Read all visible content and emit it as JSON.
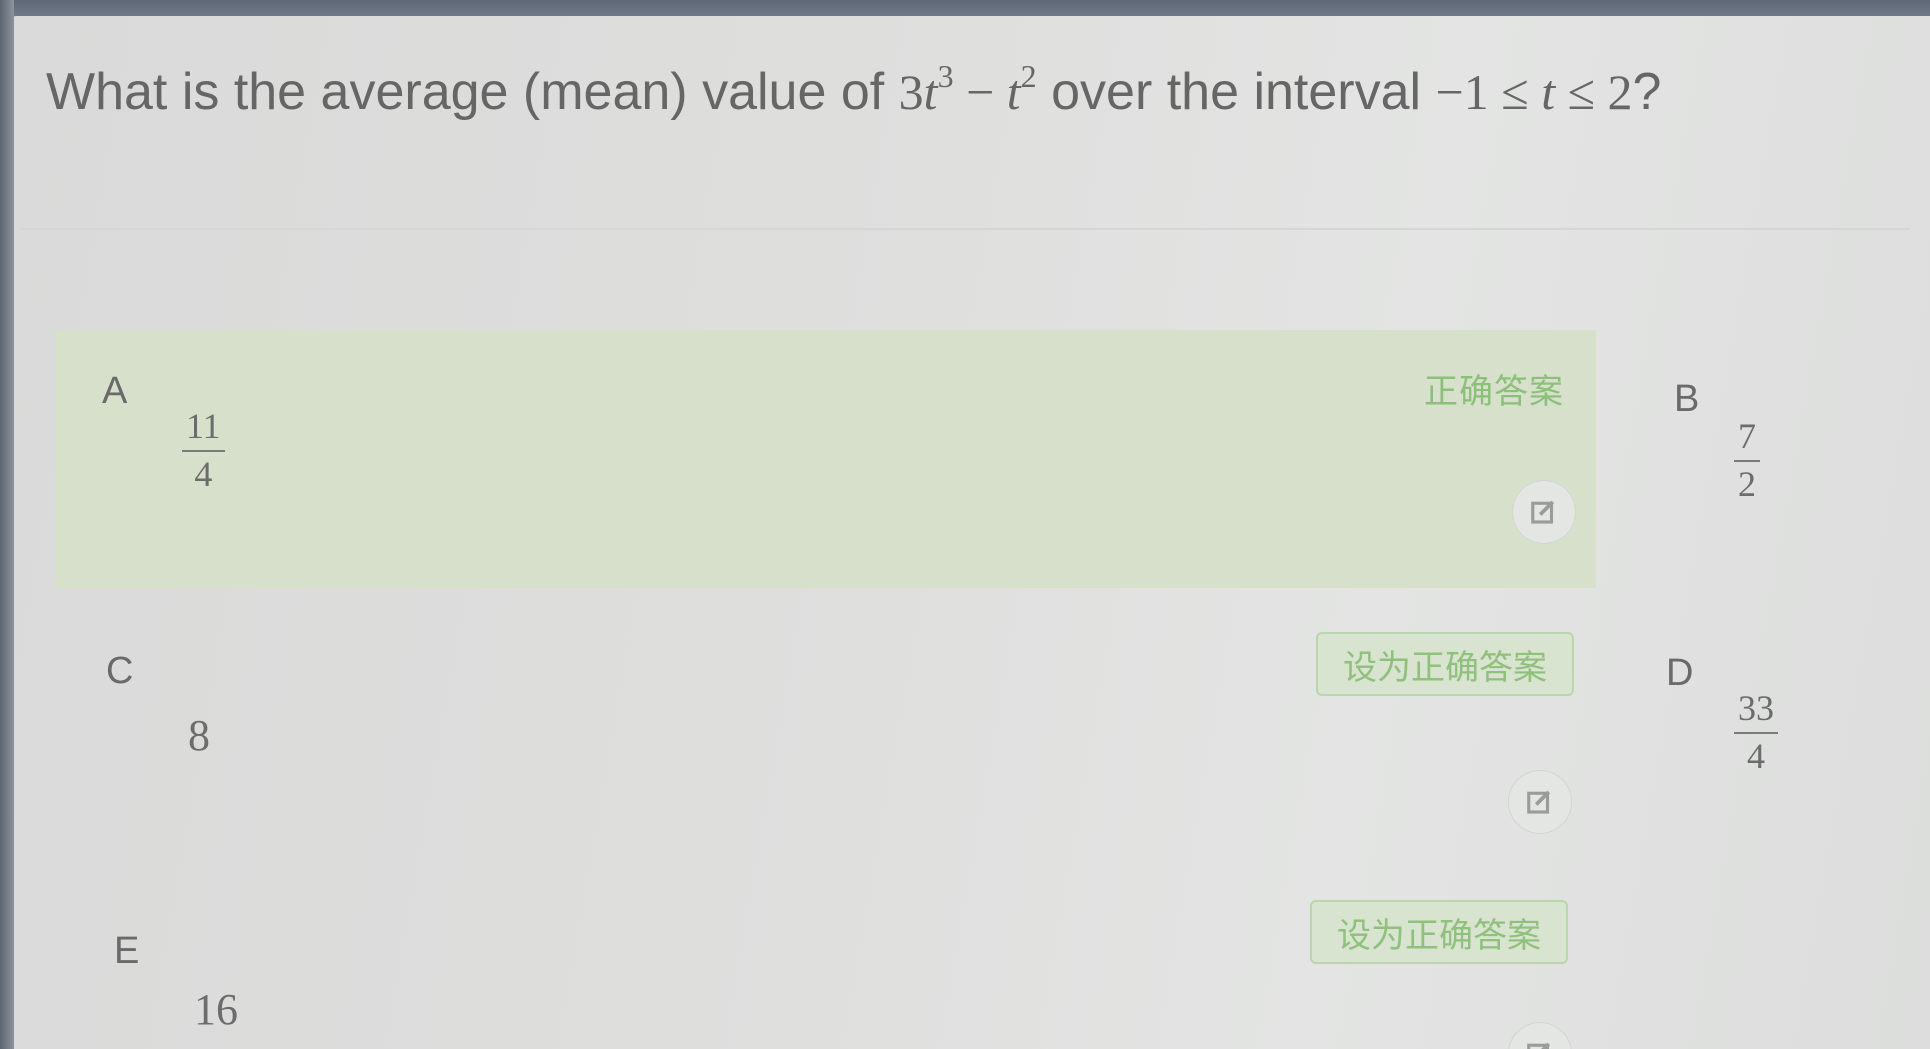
{
  "question": {
    "prefix": "What is the average (mean) value of ",
    "expr_coef": "3",
    "expr_var1": "t",
    "expr_exp1": "3",
    "expr_minus": " − ",
    "expr_var2": "t",
    "expr_exp2": "2",
    "middle": " over the interval ",
    "interval_left": "−1 ≤ ",
    "interval_var": "t",
    "interval_right": " ≤ 2",
    "suffix": "?"
  },
  "options": [
    {
      "letter": "A",
      "value_num": "11",
      "value_den": "4",
      "status_label": "正确答案"
    },
    {
      "letter": "B",
      "value_num": "7",
      "value_den": "2"
    },
    {
      "letter": "C",
      "value": "8",
      "button_label": "设为正确答案"
    },
    {
      "letter": "D",
      "value_num": "33",
      "value_den": "4"
    },
    {
      "letter": "E",
      "value": "16",
      "button_label": "设为正确答案"
    }
  ],
  "icons": {
    "edit": "edit-icon"
  },
  "colors": {
    "correct_bg": "#d6e0cb",
    "correct_text": "#8cbf7a"
  }
}
